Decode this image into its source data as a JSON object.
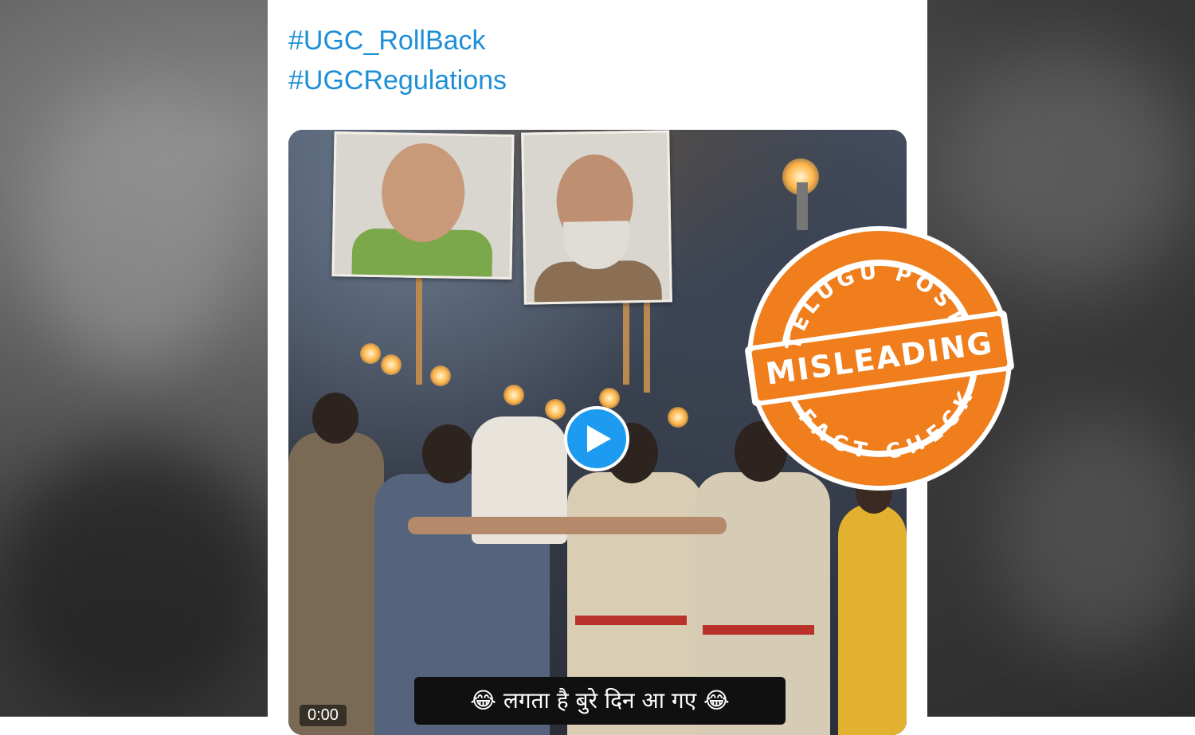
{
  "tweet": {
    "hashtags": [
      "#UGC_RollBack",
      "#UGCRegulations"
    ]
  },
  "video": {
    "caption": "😂 लगता है बुरे दिन आ गए 😂",
    "timestamp": "0:00",
    "play_icon": "play-icon"
  },
  "stamp": {
    "brand_top": "TELUGU POST",
    "verdict": "MISLEADING",
    "brand_bottom": "FACT CHECK",
    "color": "#f07e1c"
  },
  "colors": {
    "hashtag": "#1d8fd6",
    "play_button": "#1d9bf0"
  }
}
